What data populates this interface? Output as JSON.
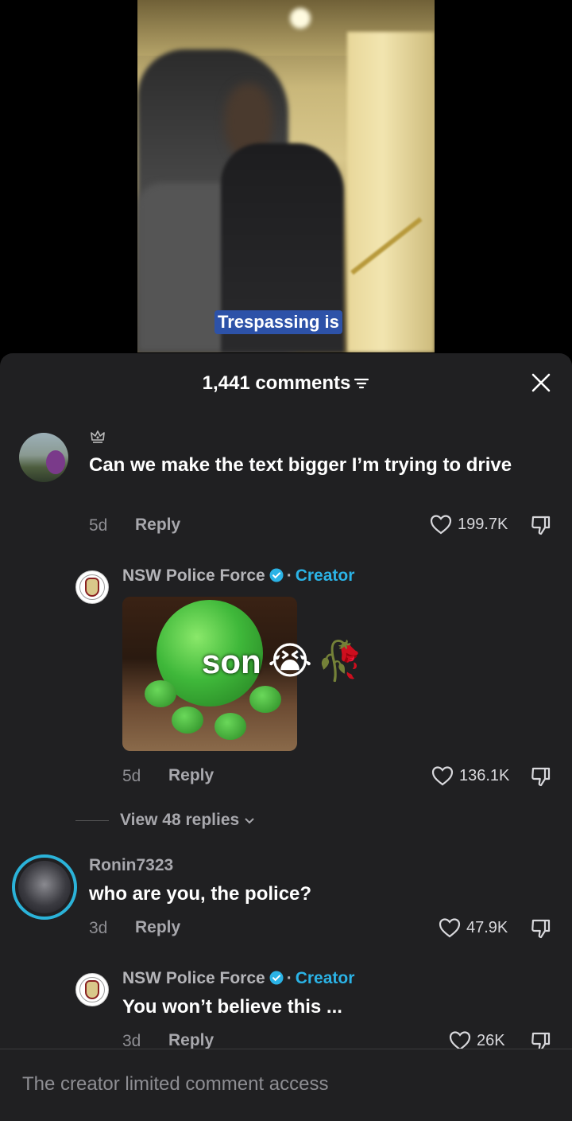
{
  "video": {
    "caption_highlight": "Trespassing",
    "caption_rest": " is"
  },
  "sheet": {
    "title": "1,441 comments"
  },
  "comments": [
    {
      "text": "Can we make the text bigger I’m trying to drive",
      "age": "5d",
      "reply_label": "Reply",
      "likes": "199.7K"
    },
    {
      "username": "NSW Police Force",
      "badge": "Creator",
      "sticker_text": "son",
      "age": "5d",
      "reply_label": "Reply",
      "likes": "136.1K"
    },
    {
      "username": "Ronin7323",
      "text": "who are you, the police?",
      "age": "3d",
      "reply_label": "Reply",
      "likes": "47.9K"
    },
    {
      "username": "NSW Police Force",
      "badge": "Creator",
      "text": "You won’t believe this ...",
      "age": "3d",
      "reply_label": "Reply",
      "likes": "26K"
    }
  ],
  "view_replies": "View 48 replies",
  "footer": {
    "notice": "The creator limited comment access"
  },
  "colors": {
    "sheet_bg": "#202022",
    "accent": "#2bb3e6",
    "caption_bg": "#2d52a8"
  }
}
